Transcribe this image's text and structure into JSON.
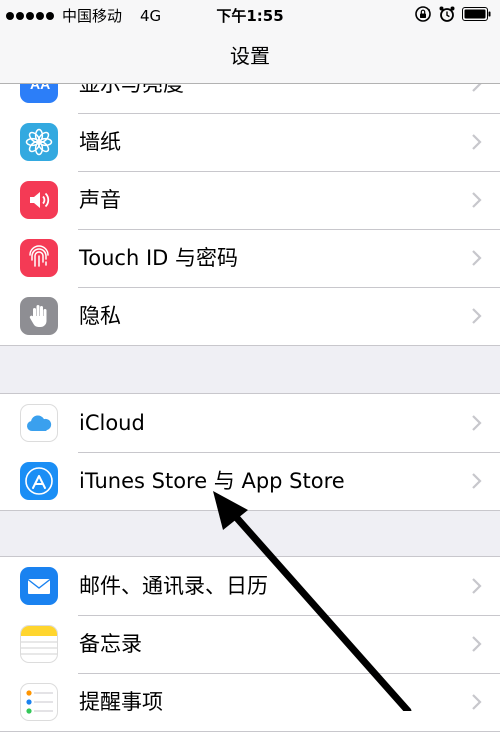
{
  "status_bar": {
    "carrier": "中国移动",
    "network": "4G",
    "time": "下午1:55"
  },
  "nav": {
    "title": "设置"
  },
  "groups": [
    {
      "items": [
        {
          "label": "显示与亮度",
          "icon": "display-brightness-icon",
          "color": "#2c7ef8"
        },
        {
          "label": "墙纸",
          "icon": "wallpaper-flower-icon",
          "color": "#33a9e0"
        },
        {
          "label": "声音",
          "icon": "speaker-icon",
          "color": "#f43a55"
        },
        {
          "label": "Touch ID 与密码",
          "icon": "fingerprint-icon",
          "color": "#f43a55"
        },
        {
          "label": "隐私",
          "icon": "hand-icon",
          "color": "#8e8e93"
        }
      ]
    },
    {
      "items": [
        {
          "label": "iCloud",
          "icon": "cloud-icon",
          "color": "#ffffff"
        },
        {
          "label": "iTunes Store 与 App Store",
          "icon": "app-store-icon",
          "color": "#1a8ef5"
        }
      ]
    },
    {
      "items": [
        {
          "label": "邮件、通讯录、日历",
          "icon": "mail-icon",
          "color": "#1a82f0"
        },
        {
          "label": "备忘录",
          "icon": "notes-icon",
          "color": "#ffd52e"
        },
        {
          "label": "提醒事项",
          "icon": "reminders-icon",
          "color": "#ffffff"
        }
      ]
    }
  ]
}
